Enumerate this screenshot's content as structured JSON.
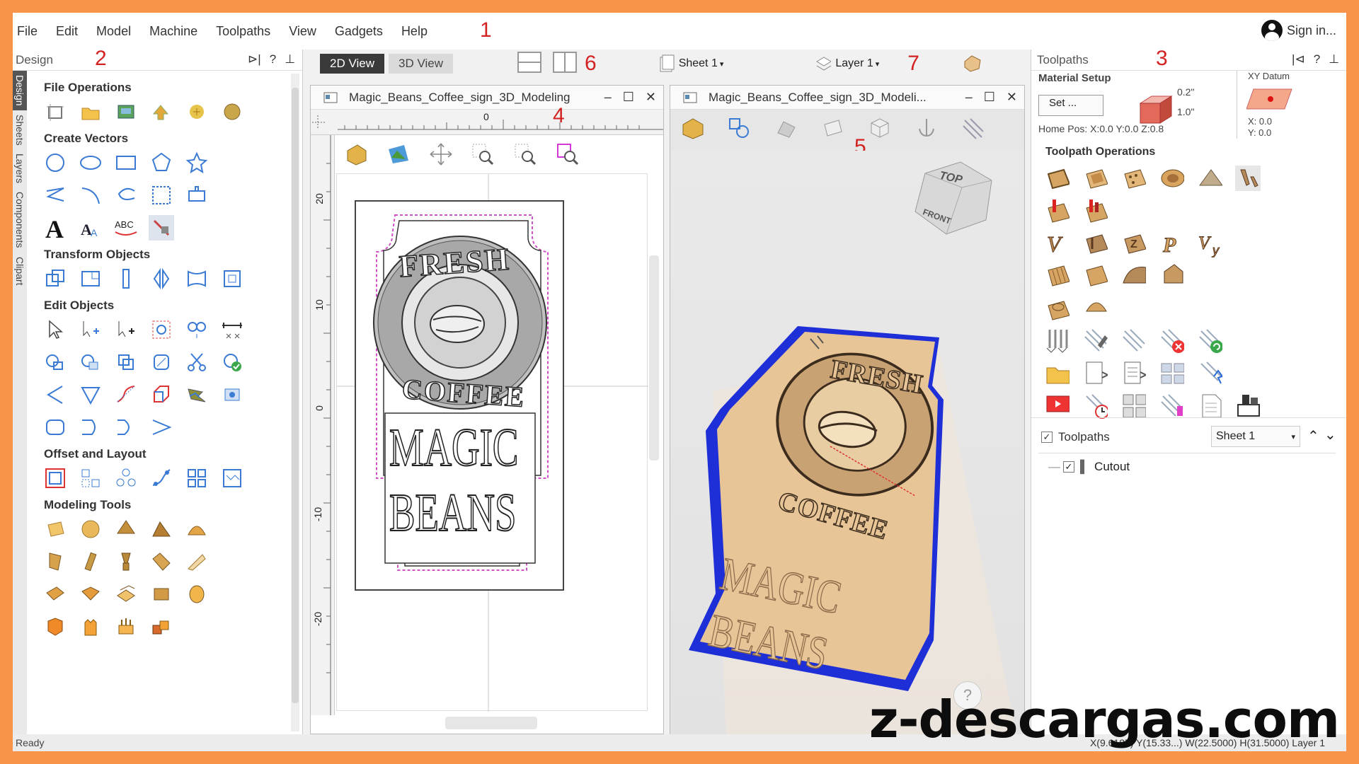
{
  "menu": [
    "File",
    "Edit",
    "Model",
    "Machine",
    "Toolpaths",
    "View",
    "Gadgets",
    "Help"
  ],
  "annotations": [
    "1",
    "2",
    "3",
    "4",
    "5",
    "6",
    "7"
  ],
  "signin": "Sign in...",
  "design_panel": {
    "title": "Design",
    "vtabs": [
      "Design",
      "Sheets",
      "Layers",
      "Components",
      "Clipart"
    ],
    "sections": [
      "File Operations",
      "Create Vectors",
      "Transform Objects",
      "Edit Objects",
      "Offset and Layout",
      "Modeling Tools"
    ]
  },
  "viewbar": {
    "view2d": "2D View",
    "view3d": "3D View",
    "sheet": "Sheet 1",
    "layer": "Layer 1"
  },
  "win2d": {
    "title": "Magic_Beans_Coffee_sign_3D_Modeling",
    "ruler_labels": [
      "20",
      "10",
      "0",
      "-10",
      "-20"
    ],
    "ruler_top": "0"
  },
  "win3d": {
    "title": "Magic_Beans_Coffee_sign_3D_Modeli...",
    "cube_top": "TOP",
    "cube_front": "FRONT",
    "help": "?"
  },
  "sign": {
    "fresh": "FRESH",
    "coffee": "COFFEE",
    "magic": "MAGIC",
    "beans": "BEANS"
  },
  "toolpaths_panel": {
    "title": "Toolpaths",
    "material_setup": "Material Setup",
    "set_button": "Set ...",
    "thickness_top": "0.2\"",
    "thickness": "1.0\"",
    "home_pos": "Home Pos:  X:0.0 Y:0.0 Z:0.8",
    "xy_datum": "XY Datum",
    "x": "X: 0.0",
    "y": "Y: 0.0",
    "operations_title": "Toolpath Operations",
    "list_label": "Toolpaths",
    "sheet_select": "Sheet 1",
    "toolpath_item": "Cutout"
  },
  "status": {
    "left": "Ready",
    "right": "X(9.6187) Y(15.33...) W(22.5000) H(31.5000) Layer 1"
  },
  "watermark": "z-descargas.com"
}
